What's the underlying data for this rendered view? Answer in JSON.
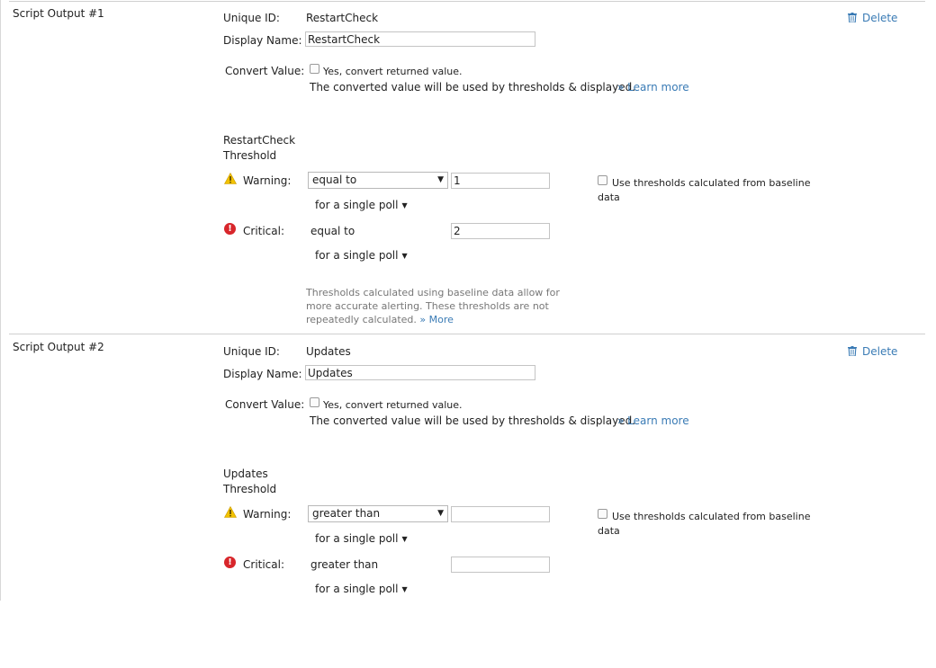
{
  "labels": {
    "unique_id": "Unique ID:",
    "display_name": "Display Name:",
    "convert_value": "Convert Value:",
    "convert_checkbox": "Yes, convert returned value.",
    "converted_note": "The converted value will be used by thresholds & displayed.",
    "learn_more": "» Learn more",
    "warning": "Warning:",
    "critical": "Critical:",
    "poll": "for a single poll",
    "baseline_checkbox": "Use thresholds calculated from baseline",
    "baseline_data": "data",
    "baseline_note": "Thresholds calculated using baseline data allow for more accurate alerting. These thresholds are not repeatedly calculated.",
    "more": "» More",
    "delete": "Delete"
  },
  "outputs": [
    {
      "title": "Script Output #1",
      "unique_id": "RestartCheck",
      "display_name": "RestartCheck",
      "threshold_title": "RestartCheck Threshold",
      "warning_operator": "equal to",
      "warning_value": "1",
      "critical_operator": "equal to",
      "critical_value": "2"
    },
    {
      "title": "Script Output #2",
      "unique_id": "Updates",
      "display_name": "Updates",
      "threshold_title": "Updates Threshold",
      "warning_operator": "greater than",
      "warning_value": "",
      "critical_operator": "greater than",
      "critical_value": ""
    }
  ],
  "colors": {
    "link": "#3a7bb5",
    "critical_icon": "#d8262b",
    "warning_icon": "#f2c200",
    "divider": "#d0d0d0"
  },
  "icons": {
    "warning": "warning-triangle-icon",
    "critical": "critical-exclamation-icon",
    "delete": "trash-icon",
    "dropdown": "chevron-down-icon"
  }
}
